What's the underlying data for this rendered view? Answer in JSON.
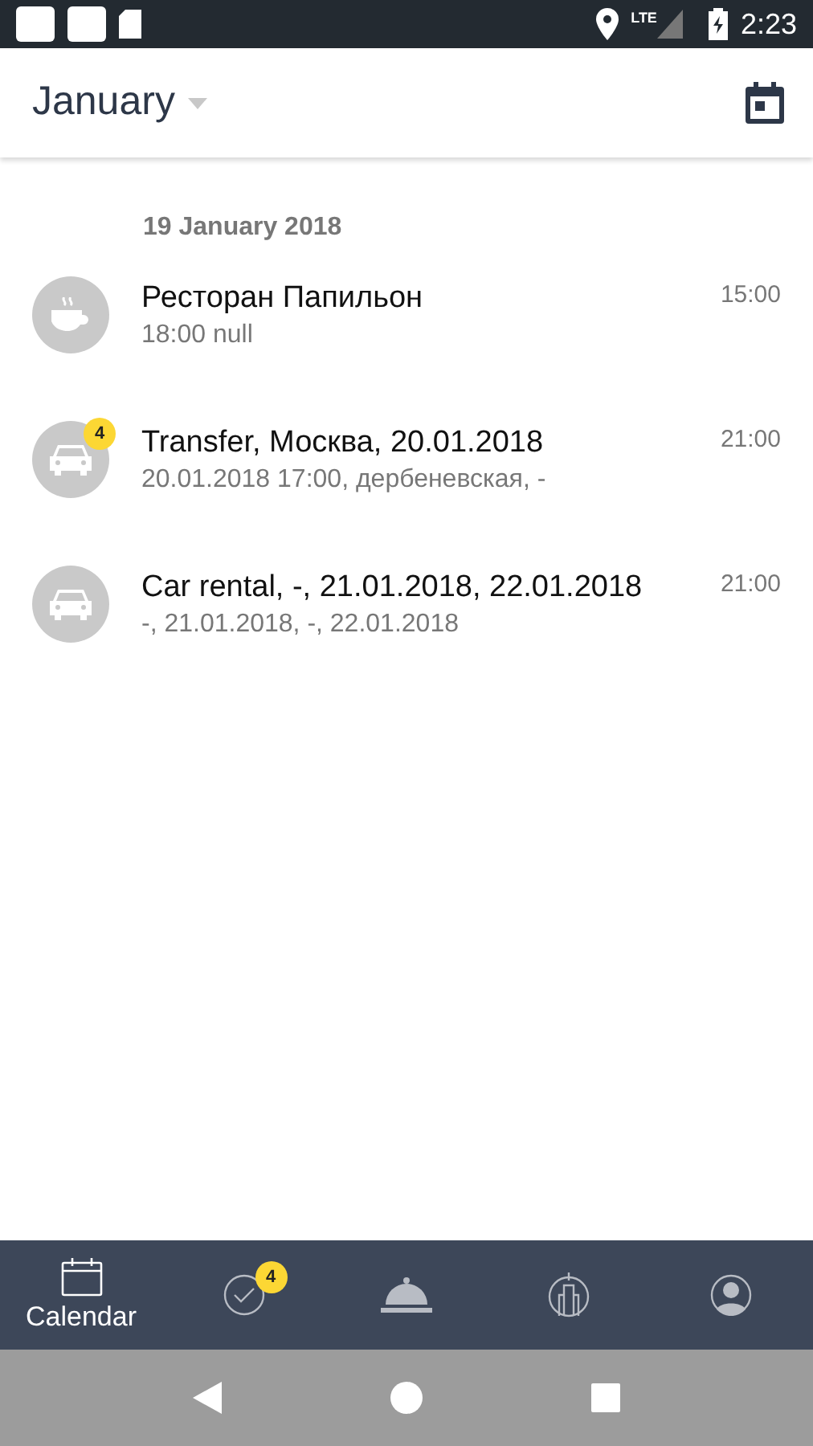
{
  "status_bar": {
    "network": "LTE",
    "time": "2:23"
  },
  "header": {
    "title": "January"
  },
  "date_heading": "19 January 2018",
  "events": [
    {
      "kind": "cafe",
      "title": "Ресторан Папильон",
      "subtitle": "18:00 null",
      "time": "15:00"
    },
    {
      "kind": "car",
      "title": "Transfer, Москва, 20.01.2018",
      "subtitle": "20.01.2018 17:00, дербеневская, -",
      "time": "21:00",
      "badge": "4"
    },
    {
      "kind": "car",
      "title": "Car rental, -, 21.01.2018, 22.01.2018",
      "subtitle": "-, 21.01.2018, -, 22.01.2018",
      "time": "21:00"
    }
  ],
  "bottom_nav": [
    {
      "kind": "calendar",
      "label": "Calendar",
      "selected": true
    },
    {
      "kind": "tasks",
      "selected": false,
      "badge": "4"
    },
    {
      "kind": "concierge",
      "selected": false
    },
    {
      "kind": "city",
      "selected": false
    },
    {
      "kind": "profile",
      "selected": false
    }
  ]
}
